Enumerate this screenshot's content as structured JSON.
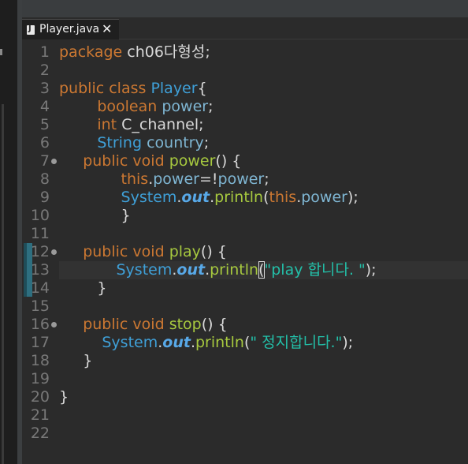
{
  "tab": {
    "title": "Player.java",
    "close": "✕"
  },
  "lines": [
    [
      [
        "kw",
        "package"
      ],
      [
        "pl",
        " ch06다형성;"
      ]
    ],
    [],
    [
      [
        "kw",
        "public"
      ],
      [
        "pl",
        " "
      ],
      [
        "kw",
        "class"
      ],
      [
        "pl",
        " "
      ],
      [
        "ty",
        "Player"
      ],
      [
        "pl",
        "{"
      ]
    ],
    [
      [
        "pl",
        "        "
      ],
      [
        "kw",
        "boolean"
      ],
      [
        "pl",
        " "
      ],
      [
        "id",
        "power"
      ],
      [
        "pl",
        ";"
      ]
    ],
    [
      [
        "pl",
        "        "
      ],
      [
        "kw",
        "int"
      ],
      [
        "pl",
        " "
      ],
      [
        "pl",
        "C_channel;"
      ]
    ],
    [
      [
        "pl",
        "        "
      ],
      [
        "ty",
        "String"
      ],
      [
        "pl",
        " "
      ],
      [
        "id",
        "country"
      ],
      [
        "pl",
        ";"
      ]
    ],
    [
      [
        "pl",
        "     "
      ],
      [
        "kw",
        "public"
      ],
      [
        "pl",
        " "
      ],
      [
        "kw",
        "void"
      ],
      [
        "pl",
        " "
      ],
      [
        "fn",
        "power"
      ],
      [
        "pl",
        "() {"
      ]
    ],
    [
      [
        "pl",
        "             "
      ],
      [
        "kw",
        "this"
      ],
      [
        "pl",
        "."
      ],
      [
        "id",
        "power"
      ],
      [
        "pl",
        "=!"
      ],
      [
        "id",
        "power"
      ],
      [
        "pl",
        ";"
      ]
    ],
    [
      [
        "pl",
        "             "
      ],
      [
        "ty",
        "System"
      ],
      [
        "pl",
        "."
      ],
      [
        "st",
        "out"
      ],
      [
        "pl",
        "."
      ],
      [
        "fn",
        "println"
      ],
      [
        "pl",
        "("
      ],
      [
        "kw",
        "this"
      ],
      [
        "pl",
        "."
      ],
      [
        "id",
        "power"
      ],
      [
        "pl",
        ");"
      ]
    ],
    [
      [
        "pl",
        "             }"
      ]
    ],
    [],
    [
      [
        "pl",
        "     "
      ],
      [
        "kw",
        "public"
      ],
      [
        "pl",
        " "
      ],
      [
        "kw",
        "void"
      ],
      [
        "pl",
        " "
      ],
      [
        "fn",
        "play"
      ],
      [
        "pl",
        "() {"
      ]
    ],
    [
      [
        "pl",
        "            "
      ],
      [
        "ty",
        "System"
      ],
      [
        "pl",
        "."
      ],
      [
        "st",
        "out"
      ],
      [
        "pl",
        "."
      ],
      [
        "fn",
        "println"
      ],
      [
        "bm",
        "("
      ],
      [
        "str",
        "\"play 합니다. \""
      ],
      [
        "pl",
        ");"
      ]
    ],
    [
      [
        "pl",
        "        }"
      ]
    ],
    [],
    [
      [
        "pl",
        "     "
      ],
      [
        "kw",
        "public"
      ],
      [
        "pl",
        " "
      ],
      [
        "kw",
        "void"
      ],
      [
        "pl",
        " "
      ],
      [
        "fn",
        "stop"
      ],
      [
        "pl",
        "() {"
      ]
    ],
    [
      [
        "pl",
        "         "
      ],
      [
        "ty",
        "System"
      ],
      [
        "pl",
        "."
      ],
      [
        "st",
        "out"
      ],
      [
        "pl",
        "."
      ],
      [
        "fn",
        "println"
      ],
      [
        "pl",
        "("
      ],
      [
        "str",
        "\" 정지합니다.\""
      ],
      [
        "pl",
        ");"
      ]
    ],
    [
      [
        "pl",
        "     }"
      ]
    ],
    [],
    [
      [
        "pl",
        "}"
      ]
    ],
    [],
    []
  ],
  "line_numbers": [
    "1",
    "2",
    "3",
    "4",
    "5",
    "6",
    "7",
    "8",
    "9",
    "10",
    "11",
    "12",
    "13",
    "14",
    "15",
    "16",
    "17",
    "18",
    "19",
    "20",
    "21",
    "22"
  ],
  "fold_markers_on_lines": [
    7,
    12,
    16
  ]
}
